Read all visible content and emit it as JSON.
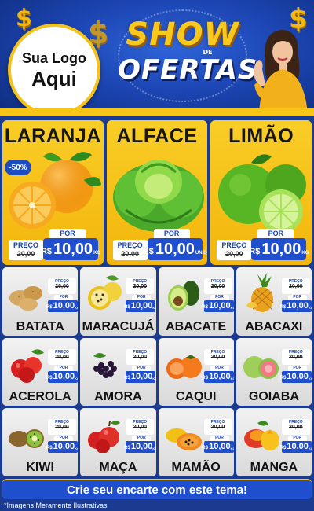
{
  "header": {
    "logo_line1": "Sua Logo",
    "logo_line2": "Aqui",
    "title_top": "SHOW",
    "title_de": "DE",
    "title_bottom": "OFERTAS",
    "dollar_symbol": "$"
  },
  "featured": [
    {
      "name": "LARANJA",
      "badge": "-50%",
      "preco_label": "PREÇO",
      "old_price": "20,00",
      "por_label": "POR",
      "currency": "R$",
      "new_price": "10,00",
      "unit": "KG",
      "icon": "orange-icon"
    },
    {
      "name": "ALFACE",
      "preco_label": "PREÇO",
      "old_price": "20,00",
      "por_label": "POR",
      "currency": "R$",
      "new_price": "10,00",
      "unit": "UNID",
      "icon": "lettuce-icon"
    },
    {
      "name": "LIMÃO",
      "preco_label": "PREÇO",
      "old_price": "20,00",
      "por_label": "POR",
      "currency": "R$",
      "new_price": "10,00",
      "unit": "KG",
      "icon": "lime-icon"
    }
  ],
  "products": [
    {
      "name": "BATATA",
      "icon": "potato-icon"
    },
    {
      "name": "MARACUJÁ",
      "icon": "passion-fruit-icon"
    },
    {
      "name": "ABACATE",
      "icon": "avocado-icon"
    },
    {
      "name": "ABACAXI",
      "icon": "pineapple-icon"
    },
    {
      "name": "ACEROLA",
      "icon": "acerola-icon"
    },
    {
      "name": "AMORA",
      "icon": "blackberry-icon"
    },
    {
      "name": "CAQUI",
      "icon": "persimmon-icon"
    },
    {
      "name": "GOIABA",
      "icon": "guava-icon"
    },
    {
      "name": "KIWI",
      "icon": "kiwi-icon"
    },
    {
      "name": "MAÇA",
      "icon": "apple-icon"
    },
    {
      "name": "MAMÃO",
      "icon": "papaya-icon"
    },
    {
      "name": "MANGA",
      "icon": "mango-icon"
    }
  ],
  "small_price": {
    "preco_label": "PREÇO",
    "old_price": "20,00",
    "por_label": "POR",
    "currency": "R$",
    "new_price": "10,00",
    "unit": "KG"
  },
  "cta": "Crie seu encarte com este tema!",
  "disclaimer": "*Imagens Meramente Ilustrativas",
  "colors": {
    "brand_blue": "#1f4fcf",
    "brand_yellow": "#f7c318",
    "dark_blue": "#1a3b8f"
  }
}
